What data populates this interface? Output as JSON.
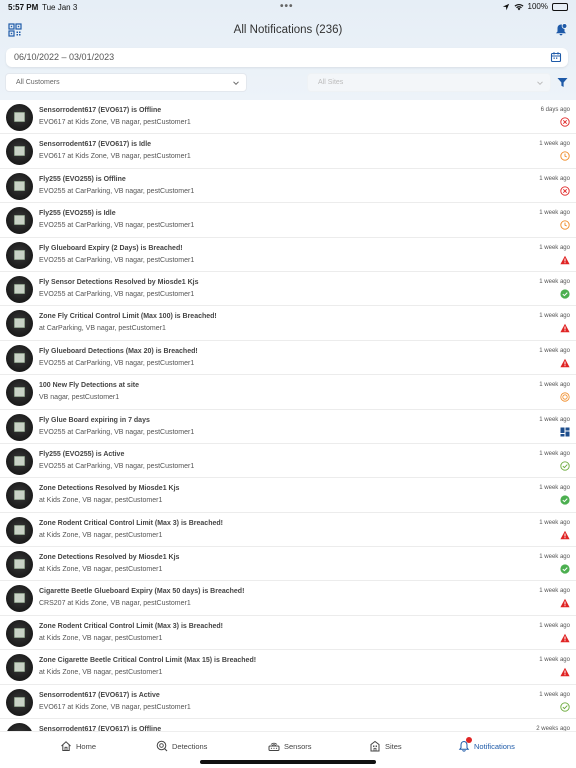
{
  "status_bar": {
    "time": "5:57 PM",
    "date": "Tue Jan 3",
    "battery": "100%"
  },
  "header": {
    "title": "All Notifications (236)"
  },
  "filters": {
    "date_range": "06/10/2022 – 03/01/2023",
    "customers": "All Customers",
    "sites": "All Sites"
  },
  "notifications": [
    {
      "title": "Sensorrodent617 (EVO617) is Offline",
      "sub": "EVO617 at Kids Zone, VB nagar, pestCustomer1",
      "time": "6  days ago",
      "status": "offline"
    },
    {
      "title": "Sensorrodent617 (EVO617) is Idle",
      "sub": "EVO617 at Kids Zone, VB nagar, pestCustomer1",
      "time": "1 week ago",
      "status": "idle"
    },
    {
      "title": "Fly255 (EVO255) is Offline",
      "sub": "EVO255 at CarParking, VB nagar, pestCustomer1",
      "time": "1 week ago",
      "status": "offline"
    },
    {
      "title": "Fly255 (EVO255) is Idle",
      "sub": "EVO255 at CarParking, VB nagar, pestCustomer1",
      "time": "1 week ago",
      "status": "idle"
    },
    {
      "title": "Fly Glueboard Expiry (2 Days) is Breached!",
      "sub": "EVO255 at CarParking, VB nagar, pestCustomer1",
      "time": "1 week ago",
      "status": "breach"
    },
    {
      "title": "Fly Sensor Detections Resolved by Miosde1 Kjs",
      "sub": "EVO255 at CarParking, VB nagar, pestCustomer1",
      "time": "1 week ago",
      "status": "resolved"
    },
    {
      "title": "Zone Fly Critical Control Limit (Max 100) is Breached!",
      "sub": "at CarParking, VB nagar, pestCustomer1",
      "time": "1 week ago",
      "status": "breach"
    },
    {
      "title": "Fly Glueboard Detections (Max 20) is Breached!",
      "sub": "EVO255 at CarParking, VB nagar, pestCustomer1",
      "time": "1 week ago",
      "status": "breach"
    },
    {
      "title": "100 New Fly Detections at site",
      "sub": "VB nagar, pestCustomer1",
      "time": "1 week ago",
      "status": "new-detections"
    },
    {
      "title": "Fly Glue Board expiring in 7 days",
      "sub": "EVO255 at CarParking, VB nagar, pestCustomer1",
      "time": "1 week ago",
      "status": "glueboard"
    },
    {
      "title": "Fly255 (EVO255) is Active",
      "sub": "EVO255 at CarParking, VB nagar, pestCustomer1",
      "time": "1 week ago",
      "status": "active"
    },
    {
      "title": "Zone Detections Resolved by Miosde1 Kjs",
      "sub": "at Kids Zone, VB nagar, pestCustomer1",
      "time": "1 week ago",
      "status": "resolved"
    },
    {
      "title": "Zone Rodent Critical Control Limit (Max 3) is Breached!",
      "sub": "at Kids Zone, VB nagar, pestCustomer1",
      "time": "1 week ago",
      "status": "breach"
    },
    {
      "title": "Zone Detections Resolved by Miosde1 Kjs",
      "sub": "at Kids Zone, VB nagar, pestCustomer1",
      "time": "1 week ago",
      "status": "resolved"
    },
    {
      "title": "Cigarette Beetle Glueboard Expiry (Max 50 days) is Breached!",
      "sub": "CRS207 at Kids Zone, VB nagar, pestCustomer1",
      "time": "1 week ago",
      "status": "breach"
    },
    {
      "title": "Zone Rodent Critical Control Limit (Max 3) is Breached!",
      "sub": "at Kids Zone, VB nagar, pestCustomer1",
      "time": "1 week ago",
      "status": "breach"
    },
    {
      "title": "Zone Cigarette Beetle Critical Control Limit (Max 15) is Breached!",
      "sub": "at Kids Zone, VB nagar, pestCustomer1",
      "time": "1 week ago",
      "status": "breach"
    },
    {
      "title": "Sensorrodent617 (EVO617) is Active",
      "sub": "EVO617 at Kids Zone, VB nagar, pestCustomer1",
      "time": "1 week ago",
      "status": "active"
    },
    {
      "title": "Sensorrodent617 (EVO617) is Offline",
      "sub": "",
      "time": "2  weeks ago",
      "status": "none"
    }
  ],
  "tabs": [
    {
      "label": "Home",
      "icon": "home-icon"
    },
    {
      "label": "Detections",
      "icon": "detections-icon"
    },
    {
      "label": "Sensors",
      "icon": "sensors-icon"
    },
    {
      "label": "Sites",
      "icon": "sites-icon"
    },
    {
      "label": "Notifications",
      "icon": "notifications-icon"
    }
  ],
  "colors": {
    "accent": "#1e5aa8",
    "breach": "#e02424",
    "resolved": "#4caf50",
    "idle": "#f08a24",
    "glueboard": "#1e4e8c"
  }
}
